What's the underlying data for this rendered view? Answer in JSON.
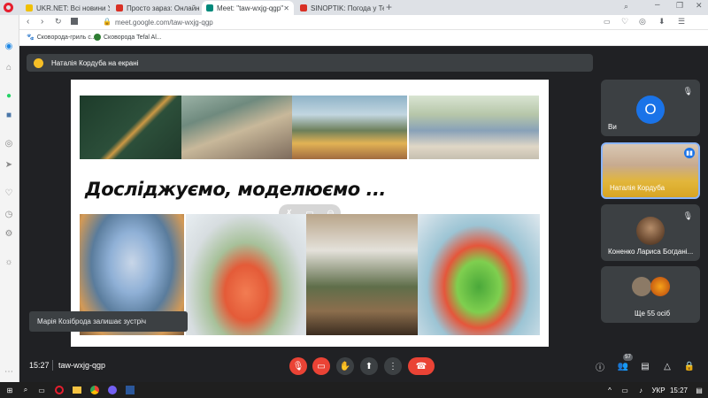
{
  "browser": {
    "tabs": [
      {
        "title": "UKR.NET: Всі новини Укра",
        "favicon_color": "#f0c000"
      },
      {
        "title": "Просто зараз: Онлайн Лек",
        "favicon_color": "#d93025"
      },
      {
        "title": "Meet: \"taw-wxjg-qgp\"",
        "favicon_color": "#00897b"
      },
      {
        "title": "SINOPTIK: Погода у Терн",
        "favicon_color": "#d93025"
      }
    ],
    "new_tab": "+",
    "address": "meet.google.com/taw-wxjg-qgp",
    "bookmarks": [
      {
        "label": "Сковорода-гриль с..."
      },
      {
        "label": "Сковорода Tefal Al..."
      }
    ]
  },
  "meet": {
    "presenting_banner": "Наталія Кордуба на екрані",
    "slide_heading": "Досліджуємо, моделюємо ...",
    "tiles": [
      {
        "name": "Ви",
        "avatar_letter": "O",
        "avatar_color": "#1a73e8"
      },
      {
        "name": "Наталія Кордуба"
      },
      {
        "name": "Коненко Лариса Богдані..."
      },
      {
        "name": "Ще 55 осіб"
      }
    ],
    "toast": "Марія Козіброда залишає зустріч",
    "time": "15:27",
    "meeting_code": "taw-wxjg-qgp",
    "participants_count": "57"
  },
  "taskbar": {
    "lang": "УКР",
    "clock": "15:27"
  }
}
